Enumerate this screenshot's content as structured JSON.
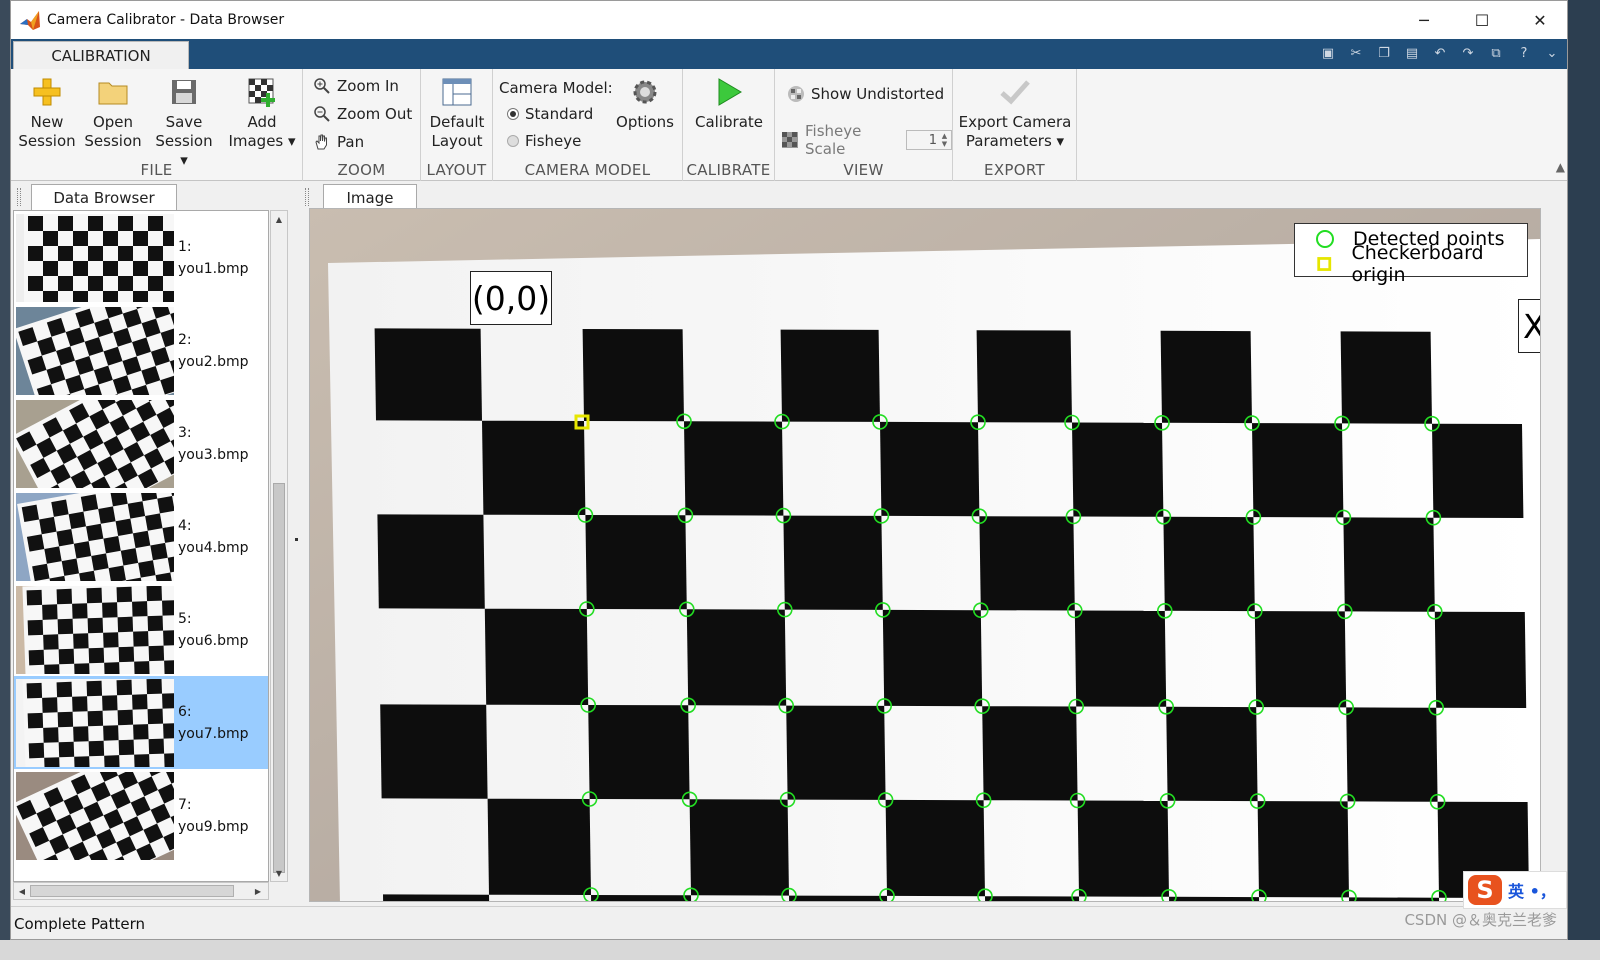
{
  "window": {
    "title": "Camera Calibrator - Data Browser",
    "minimize": "─",
    "maximize": "☐",
    "close": "✕"
  },
  "ribbon_tabs": [
    {
      "label": "CALIBRATION",
      "active": true
    }
  ],
  "ribbon": {
    "file": {
      "label": "FILE",
      "new_session": [
        "New",
        "Session"
      ],
      "open_session": [
        "Open",
        "Session"
      ],
      "save_session": [
        "Save",
        "Session ▾"
      ],
      "add_images": [
        "Add",
        "Images ▾"
      ]
    },
    "zoom": {
      "label": "ZOOM",
      "zoom_in": "Zoom In",
      "zoom_out": "Zoom Out",
      "pan": "Pan"
    },
    "layout": {
      "label": "LAYOUT",
      "default_layout": [
        "Default",
        "Layout"
      ]
    },
    "camera_model": {
      "label": "CAMERA MODEL",
      "heading": "Camera Model:",
      "standard": "Standard",
      "fisheye": "Fisheye",
      "options": "Options",
      "selected": "Standard"
    },
    "calibrate": {
      "label": "CALIBRATE",
      "calibrate": "Calibrate"
    },
    "view": {
      "label": "VIEW",
      "show_undistorted": "Show Undistorted",
      "fisheye_scale": "Fisheye Scale",
      "fisheye_scale_value": "1"
    },
    "export": {
      "label": "EXPORT",
      "export_params": [
        "Export Camera",
        "Parameters ▾"
      ]
    }
  },
  "data_browser": {
    "tab": "Data Browser",
    "items": [
      {
        "index": "1:",
        "name": "you1.bmp",
        "selected": false
      },
      {
        "index": "2:",
        "name": "you2.bmp",
        "selected": false
      },
      {
        "index": "3:",
        "name": "you3.bmp",
        "selected": false
      },
      {
        "index": "4:",
        "name": "you4.bmp",
        "selected": false
      },
      {
        "index": "5:",
        "name": "you6.bmp",
        "selected": false
      },
      {
        "index": "6:",
        "name": "you7.bmp",
        "selected": true
      },
      {
        "index": "7:",
        "name": "you9.bmp",
        "selected": false
      }
    ]
  },
  "image_panel": {
    "tab": "Image",
    "origin_label": "(0,0)",
    "axis_label": "X-",
    "legend": {
      "detected": "Detected points",
      "origin": "Checkerboard origin"
    }
  },
  "status": "Complete Pattern",
  "watermark": "CSDN @＆奥克兰老爹",
  "ime": {
    "logo": "S",
    "text": "英 •，"
  },
  "colors": {
    "ribbon_tab_bar": "#1f4e79",
    "selected_item": "#99ccff",
    "detected_point": "#22dd22",
    "origin_marker": "#e6e600"
  }
}
